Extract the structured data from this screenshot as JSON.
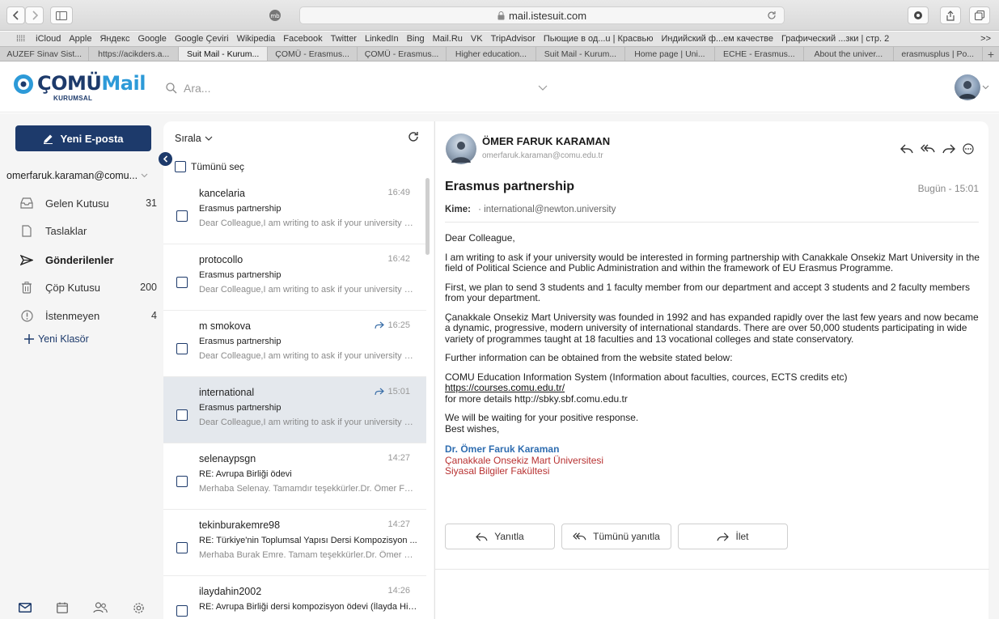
{
  "browser": {
    "url": "mail.istesuit.com",
    "bookmarks": [
      "iCloud",
      "Apple",
      "Яндекс",
      "Google",
      "Google Çeviri",
      "Wikipedia",
      "Facebook",
      "Twitter",
      "LinkedIn",
      "Bing",
      "Mail.Ru",
      "VK",
      "TripAdvisor",
      "Пьющие в од...u | Красвью",
      "Индийский ф...ем качестве",
      "Графический ...зки | стр. 2"
    ],
    "tabs": [
      {
        "label": "AUZEF Sinav Sist..."
      },
      {
        "label": "https://acikders.a..."
      },
      {
        "label": "Suit Mail - Kurum..."
      },
      {
        "label": "ÇOMÜ - Erasmus..."
      },
      {
        "label": "ÇOMÜ - Erasmus..."
      },
      {
        "label": "Higher education..."
      },
      {
        "label": "Suit Mail - Kurum..."
      },
      {
        "label": "Home page | Uni..."
      },
      {
        "label": "ECHE - Erasmus..."
      },
      {
        "label": "About the univer..."
      },
      {
        "label": "erasmusplus | Po..."
      }
    ]
  },
  "app": {
    "logo_main_1": "ÇOMÜ",
    "logo_main_2": "Mail",
    "logo_sub": "KURUMSAL",
    "search_placeholder": "Ara..."
  },
  "sidebar": {
    "compose_label": "Yeni E-posta",
    "account": "omerfaruk.karaman@comu...",
    "folders": [
      {
        "label": "Gelen Kutusu",
        "count": "31",
        "icon": "inbox-icon"
      },
      {
        "label": "Taslaklar",
        "count": "",
        "icon": "draft-icon"
      },
      {
        "label": "Gönderilenler",
        "count": "",
        "icon": "sent-icon"
      },
      {
        "label": "Çöp Kutusu",
        "count": "200",
        "icon": "trash-icon"
      },
      {
        "label": "İstenmeyen",
        "count": "4",
        "icon": "spam-icon"
      }
    ],
    "new_folder": "Yeni Klasör"
  },
  "list": {
    "sort_label": "Sırala",
    "select_all": "Tümünü seç",
    "messages": [
      {
        "sender": "kancelaria",
        "time": "16:49",
        "forwarded": false,
        "subject": "Erasmus partnership",
        "preview": "Dear Colleague,I am writing to ask if your university w..."
      },
      {
        "sender": "protocollo",
        "time": "16:42",
        "forwarded": false,
        "subject": "Erasmus partnership",
        "preview": "Dear Colleague,I am writing to ask if your university w..."
      },
      {
        "sender": "m smokova",
        "time": "16:25",
        "forwarded": true,
        "subject": "Erasmus partnership",
        "preview": "Dear Colleague,I am writing to ask if your university w..."
      },
      {
        "sender": "international",
        "time": "15:01",
        "forwarded": true,
        "subject": "Erasmus partnership",
        "preview": "Dear Colleague,I am writing to ask if your university w..."
      },
      {
        "sender": "selenaypsgn",
        "time": "14:27",
        "forwarded": false,
        "subject": "RE: Avrupa Birliği ödevi",
        "preview": "Merhaba Selenay. Tamamdır teşekkürler.Dr. Ömer Far..."
      },
      {
        "sender": "tekinburakemre98",
        "time": "14:27",
        "forwarded": false,
        "subject": "RE: Türkiye'nin Toplumsal Yapısı Dersi Kompozisyon ...",
        "preview": "Merhaba Burak Emre. Tamam teşekkürler.Dr. Ömer Fa..."
      },
      {
        "sender": "ilaydahin2002",
        "time": "14:26",
        "forwarded": false,
        "subject": "RE: Avrupa Birliği dersi kompozisyon ödevi (İlayda Hin...",
        "preview": ""
      }
    ]
  },
  "reader": {
    "from_name": "ÖMER FARUK KARAMAN",
    "from_email": "omerfaruk.karaman@comu.edu.tr",
    "subject": "Erasmus partnership",
    "date": "Bugün - 15:01",
    "to_label": "Kime:",
    "to": "· international@newton.university",
    "body": {
      "greeting": "Dear Colleague,",
      "p1": "I am writing to ask if your university would be interested in forming partnership with Canakkale Onsekiz Mart University in the field of Political Science and Public Administration and within the framework of EU Erasmus Programme.",
      "p2": "First, we plan to send 3 students and 1 faculty member from our department and accept 3 students and 2 faculty members from your department.",
      "p3": "Çanakkale Onsekiz Mart University was founded in 1992 and has expanded rapidly over the last few years and now became a dynamic, progressive, modern university of international standards. There are over 50,000 students participating in wide variety of programmes taught at 18 faculties and 13 vocational colleges and state conservatory.",
      "p4": "Further information can be obtained from the website stated below:",
      "p5a": "COMU Education Information System (Information about faculties, cources, ECTS credits etc)",
      "p5b": "https://courses.comu.edu.tr/",
      "p5c": "for more details http://sbky.sbf.comu.edu.tr",
      "p6a": "We will be waiting for your positive response.",
      "p6b": "Best wishes,",
      "sig_name": "Dr. Ömer Faruk Karaman",
      "sig_1": "Çanakkale Onsekiz Mart Üniversitesi",
      "sig_2": "Siyasal Bilgiler Fakültesi"
    },
    "reply": "Yanıtla",
    "reply_all": "Tümünü yanıtla",
    "forward": "İlet"
  },
  "colors": {
    "brand_navy": "#1d3a6b",
    "brand_blue": "#2d9ad8",
    "signature_blue": "#2f6db0",
    "signature_red": "#b83232",
    "selected_row": "#e4e8ed"
  }
}
